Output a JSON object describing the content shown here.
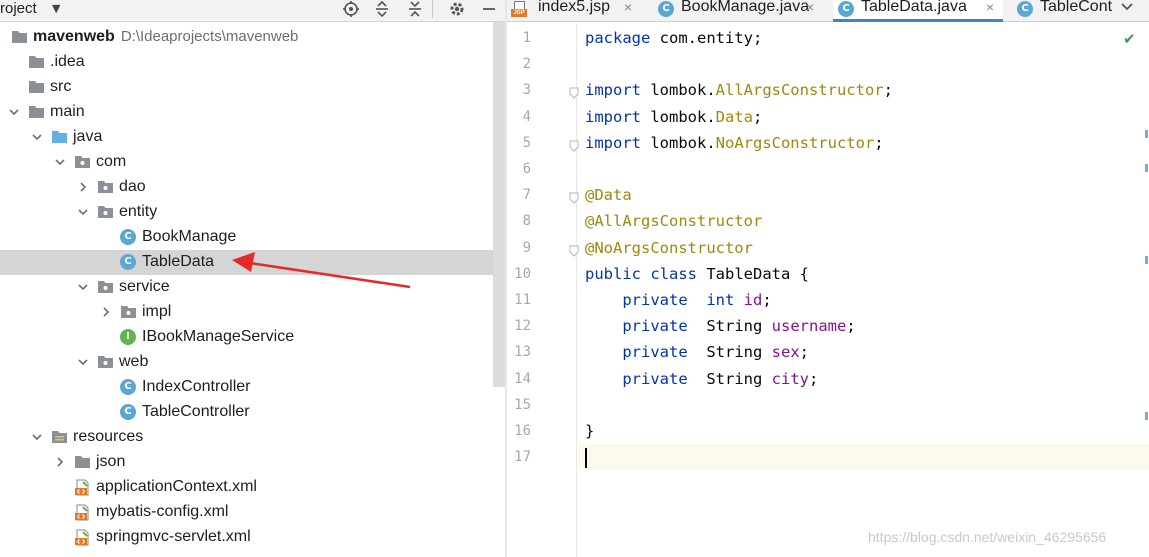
{
  "project_panel": {
    "title": "roject",
    "header_icons": [
      "locate-icon",
      "expand-all-icon",
      "collapse-all-icon",
      "gear-icon",
      "minimize-icon"
    ],
    "tree": [
      {
        "label": "mavenweb",
        "path": "D:\\Ideaprojects\\mavenweb",
        "icon": "module-folder",
        "expanded": true,
        "bold": true
      },
      {
        "label": ".idea",
        "icon": "folder"
      },
      {
        "label": "src",
        "icon": "folder"
      },
      {
        "label": "main",
        "icon": "folder",
        "expanded": true
      },
      {
        "label": "java",
        "icon": "source-folder",
        "expanded": true
      },
      {
        "label": "com",
        "icon": "package",
        "expanded": true
      },
      {
        "label": "dao",
        "icon": "package",
        "expanded": false
      },
      {
        "label": "entity",
        "icon": "package",
        "expanded": true
      },
      {
        "label": "BookManage",
        "icon": "class"
      },
      {
        "label": "TableData",
        "icon": "class",
        "selected": true
      },
      {
        "label": "service",
        "icon": "package",
        "expanded": true
      },
      {
        "label": "impl",
        "icon": "package",
        "expanded": false
      },
      {
        "label": "IBookManageService",
        "icon": "interface"
      },
      {
        "label": "web",
        "icon": "package",
        "expanded": true
      },
      {
        "label": "IndexController",
        "icon": "class"
      },
      {
        "label": "TableController",
        "icon": "class"
      },
      {
        "label": "resources",
        "icon": "resources-folder",
        "expanded": true
      },
      {
        "label": "json",
        "icon": "folder",
        "expanded": false
      },
      {
        "label": "applicationContext.xml",
        "icon": "xml-file"
      },
      {
        "label": "mybatis-config.xml",
        "icon": "xml-file"
      },
      {
        "label": "springmvc-servlet.xml",
        "icon": "xml-file"
      }
    ]
  },
  "editor": {
    "tabs": [
      {
        "label": "index5.jsp",
        "icon": "jsp-file-icon",
        "badge": "JSP",
        "closable": true
      },
      {
        "label": "BookManage.java",
        "icon": "class-icon",
        "closable": true
      },
      {
        "label": "TableData.java",
        "icon": "class-icon",
        "closable": true,
        "active": true
      },
      {
        "label": "TableCont",
        "icon": "class-icon"
      }
    ],
    "tab_overflow_icon": "chevron-down-icon",
    "tab_close_glyph": "×",
    "class_icon_letter": "C",
    "interface_icon_letter": "I",
    "status_icon": "checkmark-icon",
    "lines": [
      {
        "n": "1",
        "tokens": [
          {
            "t": "package",
            "c": "kw"
          },
          {
            "t": " com.entity;",
            "c": ""
          }
        ]
      },
      {
        "n": "2",
        "tokens": []
      },
      {
        "n": "3",
        "tokens": [
          {
            "t": "import",
            "c": "kw"
          },
          {
            "t": " lombok.",
            "c": ""
          },
          {
            "t": "AllArgsConstructor",
            "c": "ann"
          },
          {
            "t": ";",
            "c": ""
          }
        ]
      },
      {
        "n": "4",
        "tokens": [
          {
            "t": "import",
            "c": "kw"
          },
          {
            "t": " lombok.",
            "c": ""
          },
          {
            "t": "Data",
            "c": "ann"
          },
          {
            "t": ";",
            "c": ""
          }
        ]
      },
      {
        "n": "5",
        "tokens": [
          {
            "t": "import",
            "c": "kw"
          },
          {
            "t": " lombok.",
            "c": ""
          },
          {
            "t": "NoArgsConstructor",
            "c": "ann"
          },
          {
            "t": ";",
            "c": ""
          }
        ]
      },
      {
        "n": "6",
        "tokens": []
      },
      {
        "n": "7",
        "tokens": [
          {
            "t": "@Data",
            "c": "ann"
          }
        ]
      },
      {
        "n": "8",
        "tokens": [
          {
            "t": "@AllArgsConstructor",
            "c": "ann"
          }
        ]
      },
      {
        "n": "9",
        "tokens": [
          {
            "t": "@NoArgsConstructor",
            "c": "ann"
          }
        ]
      },
      {
        "n": "10",
        "tokens": [
          {
            "t": "public",
            "c": "kw"
          },
          {
            "t": " ",
            "c": ""
          },
          {
            "t": "class",
            "c": "kw"
          },
          {
            "t": " TableData {",
            "c": ""
          }
        ]
      },
      {
        "n": "11",
        "tokens": [
          {
            "t": "    ",
            "c": ""
          },
          {
            "t": "private",
            "c": "kw"
          },
          {
            "t": "  ",
            "c": ""
          },
          {
            "t": "int",
            "c": "kw"
          },
          {
            "t": " ",
            "c": ""
          },
          {
            "t": "id",
            "c": "fld"
          },
          {
            "t": ";",
            "c": ""
          }
        ]
      },
      {
        "n": "12",
        "tokens": [
          {
            "t": "    ",
            "c": ""
          },
          {
            "t": "private",
            "c": "kw"
          },
          {
            "t": "  String ",
            "c": ""
          },
          {
            "t": "username",
            "c": "fld"
          },
          {
            "t": ";",
            "c": ""
          }
        ]
      },
      {
        "n": "13",
        "tokens": [
          {
            "t": "    ",
            "c": ""
          },
          {
            "t": "private",
            "c": "kw"
          },
          {
            "t": "  String ",
            "c": ""
          },
          {
            "t": "sex",
            "c": "fld"
          },
          {
            "t": ";",
            "c": ""
          }
        ]
      },
      {
        "n": "14",
        "tokens": [
          {
            "t": "    ",
            "c": ""
          },
          {
            "t": "private",
            "c": "kw"
          },
          {
            "t": "  String ",
            "c": ""
          },
          {
            "t": "city",
            "c": "fld"
          },
          {
            "t": ";",
            "c": ""
          }
        ]
      },
      {
        "n": "15",
        "tokens": []
      },
      {
        "n": "16",
        "tokens": [
          {
            "t": "}",
            "c": ""
          }
        ]
      },
      {
        "n": "17",
        "tokens": [],
        "current": true
      }
    ],
    "fold_markers_on_lines": [
      "3",
      "5",
      "7",
      "9"
    ]
  },
  "annotation": {
    "type": "red-arrow",
    "points_to": "TableData"
  },
  "watermark": "https://blog.csdn.net/weixin_46295656",
  "colors": {
    "keyword": "#0033b3",
    "annotation": "#9e880d",
    "field": "#871094",
    "selected_row": "#d5d5d5",
    "active_tab_underline": "#4083c9",
    "arrow": "#e8272b",
    "current_line": "#fcfaed"
  }
}
